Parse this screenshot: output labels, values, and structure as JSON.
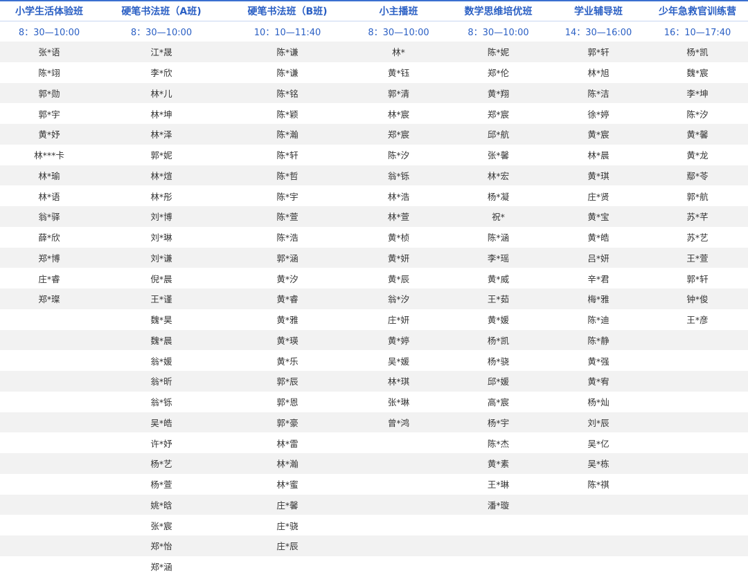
{
  "classes": [
    {
      "title": "小学生活体验班",
      "time": "8：30—10:00",
      "students": [
        "张*语",
        "陈*翊",
        "郭*勋",
        "郭*宇",
        "黄*妤",
        "林***卡",
        "林*瑜",
        "林*语",
        "翁*驿",
        "薛*欣",
        "郑*博",
        "庄*睿",
        "郑*璨"
      ]
    },
    {
      "title": "硬笔书法班（A班)",
      "time": "8：30—10:00",
      "students": [
        "江*晟",
        "李*欣",
        "林*儿",
        "林*坤",
        "林*泽",
        "郭*妮",
        "林*煊",
        "林*彤",
        "刘*博",
        "刘*琳",
        "刘*谦",
        "倪*晨",
        "王*谨",
        "魏*昊",
        "魏*晨",
        "翁*媛",
        "翁*昕",
        "翁*铄",
        "吴*皓",
        "许*妤",
        "杨*艺",
        "杨*萱",
        "姚*晗",
        "张*宸",
        "郑*怡",
        "郑*涵"
      ]
    },
    {
      "title": "硬笔书法班（B班)",
      "time": "10：10—11:40",
      "students": [
        "陈*谦",
        "陈*谦",
        "陈*铭",
        "陈*颖",
        "陈*瀚",
        "陈*轩",
        "陈*哲",
        "陈*宇",
        "陈*萱",
        "陈*浩",
        "郭*涵",
        "黄*汐",
        "黄*睿",
        "黄*雅",
        "黄*瑛",
        "黄*乐",
        "郭*辰",
        "郭*恩",
        "郭*豪",
        "林*雷",
        "林*瀚",
        "林*蜜",
        "庄*馨",
        "庄*骁",
        "庄*辰"
      ]
    },
    {
      "title": "小主播班",
      "time": "8：30—10:00",
      "students": [
        "林*",
        "黄*钰",
        "郭*清",
        "林*宸",
        "郑*宸",
        "陈*汐",
        "翁*铄",
        "林*浩",
        "林*萱",
        "黄*桢",
        "黄*妍",
        "黄*辰",
        "翁*汐",
        "庄*妍",
        "黄*婷",
        "吴*媛",
        "林*琪",
        "张*琳",
        "曾*鸿"
      ]
    },
    {
      "title": "数学思维培优班",
      "time": "8：30—10:00",
      "students": [
        "陈*妮",
        "郑*伦",
        "黄*翔",
        "郑*宸",
        "邱*航",
        "张*馨",
        "林*宏",
        "杨*凝",
        "祝*",
        "陈*涵",
        "李*瑶",
        "黄*威",
        "王*茹",
        "黄*媛",
        "杨*凯",
        "杨*骁",
        "邱*媛",
        "高*宸",
        "杨*宇",
        "陈*杰",
        "黄*素",
        "王*琳",
        "潘*璇"
      ]
    },
    {
      "title": "学业辅导班",
      "time": "14：30—16:00",
      "students": [
        "郭*轩",
        "林*旭",
        "陈*洁",
        "徐*婷",
        "黄*宸",
        "林*晨",
        "黄*琪",
        "庄*贤",
        "黄*宝",
        "黄*皓",
        "吕*妍",
        "辛*君",
        "梅*雅",
        "陈*迪",
        "陈*静",
        "黄*强",
        "黄*宥",
        "杨*灿",
        "刘*辰",
        "吴*亿",
        "吴*栋",
        "陈*祺"
      ]
    },
    {
      "title": "少年急救官训练营",
      "time": "16：10—17:40",
      "students": [
        "杨*凯",
        "魏*宸",
        "李*坤",
        "陈*汐",
        "黄*馨",
        "黄*龙",
        "鄢*苓",
        "郭*航",
        "苏*芊",
        "苏*艺",
        "王*萱",
        "郭*轩",
        "钟*俊",
        "王*彦"
      ]
    }
  ],
  "row_count": 26
}
